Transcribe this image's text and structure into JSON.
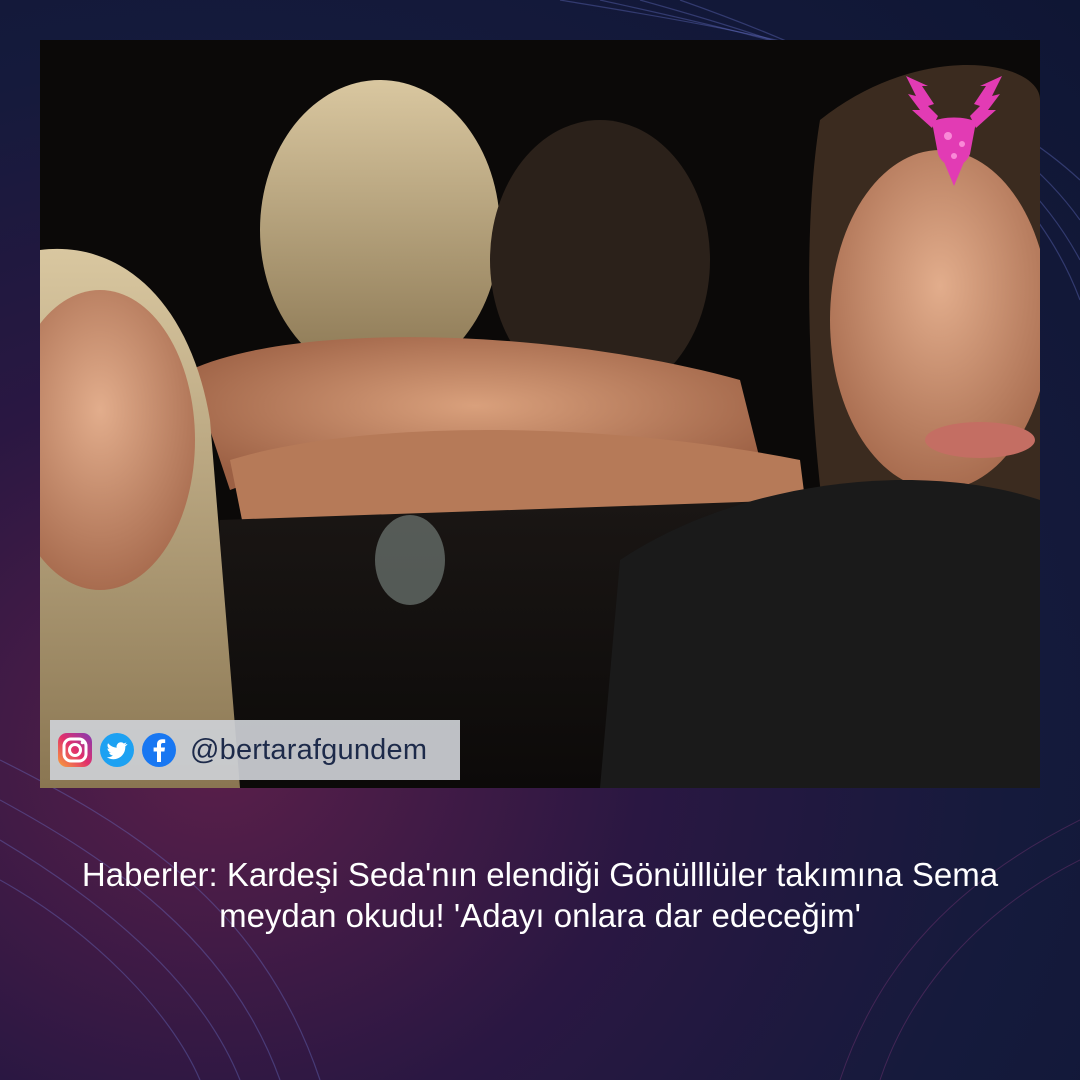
{
  "post": {
    "image_alt": "",
    "social": {
      "icons": [
        "instagram-icon",
        "twitter-icon",
        "facebook-icon"
      ],
      "handle": "@bertarafgundem"
    },
    "headline": "Haberler: Kardeşi Seda'nın elendiği Gönülllüler takımına Sema meydan okudu! 'Adayı onlara dar edeceğim'"
  },
  "colors": {
    "background_dark": "#0f1634",
    "background_magenta": "#5a1f4a",
    "accent_lines": "#6f7bd6",
    "logo_magenta": "#e23bb4",
    "social_bar": "#cdd0d6",
    "handle_text": "#1d2a4a",
    "headline_text": "#ffffff"
  }
}
